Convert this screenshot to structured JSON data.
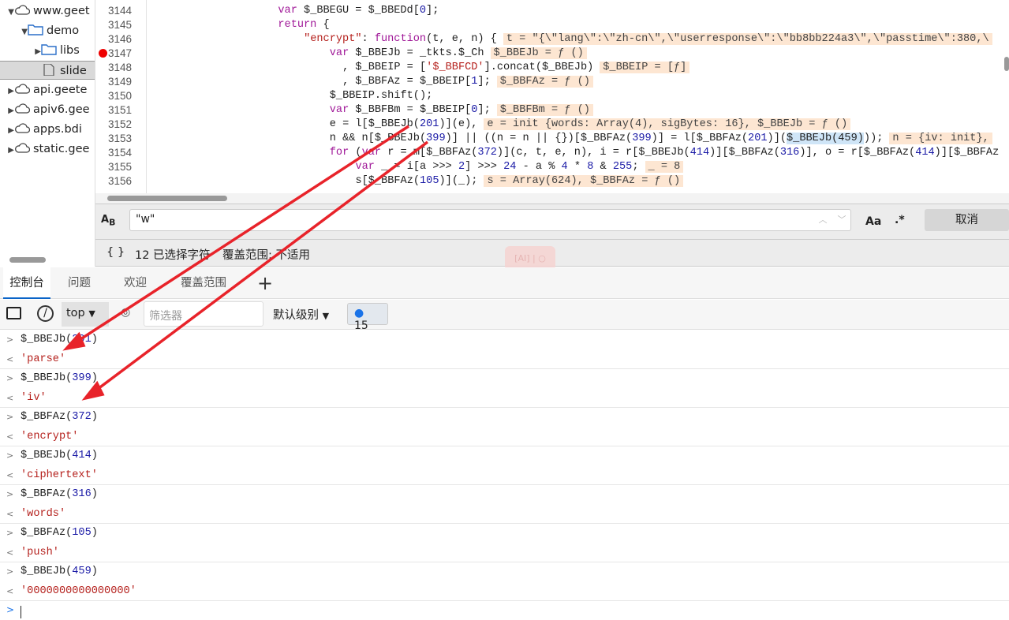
{
  "tree": [
    {
      "label": "www.geet",
      "expanded": true,
      "icon": "cloud-icon",
      "level": 1
    },
    {
      "label": "demo",
      "expanded": true,
      "icon": "folder-icon",
      "level": 2
    },
    {
      "label": "libs",
      "expanded": false,
      "icon": "folder-icon",
      "level": 3
    },
    {
      "label": "slide",
      "icon": "file-icon",
      "level": 3,
      "selected": true
    },
    {
      "label": "api.geete",
      "expanded": false,
      "icon": "cloud-icon",
      "level": 1
    },
    {
      "label": "apiv6.gee",
      "expanded": false,
      "icon": "cloud-icon",
      "level": 1
    },
    {
      "label": "apps.bdi",
      "expanded": false,
      "icon": "cloud-icon",
      "level": 1
    },
    {
      "label": "static.gee",
      "expanded": false,
      "icon": "cloud-icon",
      "level": 1
    }
  ],
  "code": {
    "breakpoint_line": "3147",
    "lines": [
      {
        "n": "3144",
        "indent": 20,
        "code": "var $_BBEGU = $_BBEDd[0];",
        "val": ""
      },
      {
        "n": "3145",
        "indent": 20,
        "code": "return {",
        "val": ""
      },
      {
        "n": "3146",
        "indent": 24,
        "code": "\"encrypt\": function(t, e, n) {",
        "val": "t = \"{\\\"lang\\\":\\\"zh-cn\\\",\\\"userresponse\\\":\\\"bb8bb224a3\\\",\\\"passtime\\\":380,\\"
      },
      {
        "n": "3147",
        "indent": 28,
        "code": "var $_BBEJb = _tkts.$_Ch",
        "val": "$_BBEJb = ƒ ()"
      },
      {
        "n": "3148",
        "indent": 30,
        "code": ", $_BBEIP = ['$_BBFCD'].concat($_BBEJb)",
        "val": "$_BBEIP = [ƒ]"
      },
      {
        "n": "3149",
        "indent": 30,
        "code": ", $_BBFAz = $_BBEIP[1];",
        "val": "$_BBFAz = ƒ ()"
      },
      {
        "n": "3150",
        "indent": 28,
        "code": "$_BBEIP.shift();",
        "val": ""
      },
      {
        "n": "3151",
        "indent": 28,
        "code": "var $_BBFBm = $_BBEIP[0];",
        "val": "$_BBFBm = ƒ ()"
      },
      {
        "n": "3152",
        "indent": 28,
        "code": "e = l[$_BBEJb(201)](e),",
        "val": "e = init {words: Array(4), sigBytes: 16}, $_BBEJb = ƒ ()"
      },
      {
        "n": "3153",
        "indent": 28,
        "code": "n && n[$_BBEJb(399)] || ((n = n || {})[$_BBFAz(399)] = l[$_BBFAz(201)]($_BBEJb(459)));",
        "val": "n = {iv: init},",
        "highlight": "$_BBEJb(459)"
      },
      {
        "n": "3154",
        "indent": 28,
        "code": "for (var r = m[$_BBFAz(372)](c, t, e, n), i = r[$_BBEJb(414)][$_BBFAz(316)], o = r[$_BBFAz(414)][$_BBFAz",
        "val": ""
      },
      {
        "n": "3155",
        "indent": 32,
        "code": "var _ = i[a >>> 2] >>> 24 - a % 4 * 8 & 255;",
        "val": "_ = 8"
      },
      {
        "n": "3156",
        "indent": 32,
        "code": "s[$_BBFAz(105)](_);",
        "val": "s = Array(624), $_BBFAz = ƒ ()"
      }
    ]
  },
  "search": {
    "value": "\"w\"",
    "case_label": "Aa",
    "regex_label": ".*",
    "cancel_label": "取消"
  },
  "status": {
    "selected": "12 已选择字符",
    "coverage": "覆盖范围: 不适用",
    "braces": "{ }"
  },
  "tabs": [
    {
      "label": "控制台",
      "active": true
    },
    {
      "label": "问题"
    },
    {
      "label": "欢迎"
    },
    {
      "label": "覆盖范围"
    },
    {
      "label": "+"
    }
  ],
  "toolbar": {
    "context": "top",
    "filter_placeholder": "筛选器",
    "level": "默认级别",
    "message_count": "15"
  },
  "console": [
    {
      "input": "$_BBEJb(201)",
      "output": "'parse'"
    },
    {
      "input": "$_BBEJb(399)",
      "output": "'iv'"
    },
    {
      "input": "$_BBFAz(372)",
      "output": "'encrypt'"
    },
    {
      "input": "$_BBEJb(414)",
      "output": "'ciphertext'"
    },
    {
      "input": "$_BBFAz(316)",
      "output": "'words'"
    },
    {
      "input": "$_BBFAz(105)",
      "output": "'push'"
    },
    {
      "input": "$_BBEJb(459)",
      "output": "'0000000000000000'"
    }
  ],
  "annotation_color": "#e8232a"
}
